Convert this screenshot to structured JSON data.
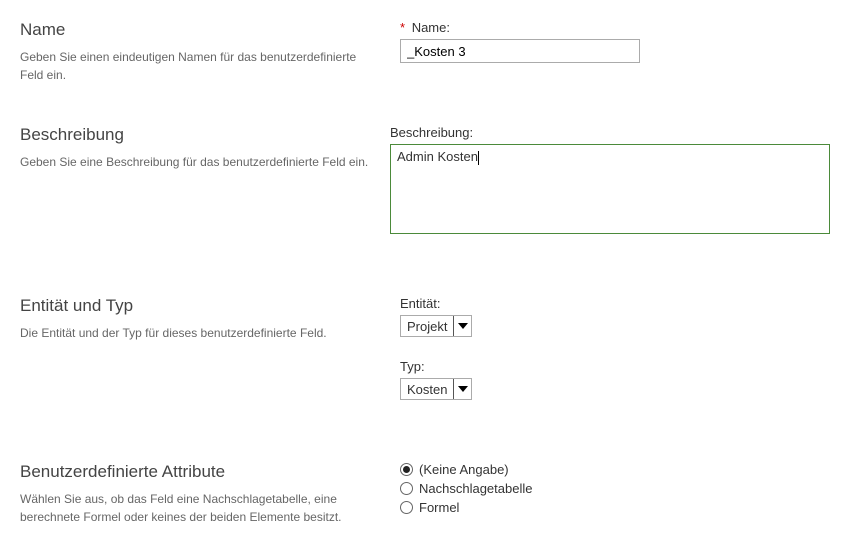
{
  "sections": {
    "name": {
      "title": "Name",
      "desc": "Geben Sie einen eindeutigen Namen für das benutzerdefinierte Feld ein.",
      "field_label": "Name:",
      "required_mark": "*",
      "value": "_Kosten 3"
    },
    "description": {
      "title": "Beschreibung",
      "desc": "Geben Sie eine Beschreibung für das benutzerdefinierte Feld ein.",
      "field_label": "Beschreibung:",
      "value": "Admin Kosten"
    },
    "entity_type": {
      "title": "Entität und Typ",
      "desc": "Die Entität und der Typ für dieses benutzerdefinierte Feld.",
      "entity_label": "Entität:",
      "entity_value": "Projekt",
      "type_label": "Typ:",
      "type_value": "Kosten"
    },
    "attributes": {
      "title": "Benutzerdefinierte Attribute",
      "desc": "Wählen Sie aus, ob das Feld eine Nachschlagetabelle, eine berechnete Formel oder keines der beiden Elemente besitzt.",
      "options": [
        {
          "label": "(Keine Angabe)",
          "selected": true
        },
        {
          "label": "Nachschlagetabelle",
          "selected": false
        },
        {
          "label": "Formel",
          "selected": false
        }
      ]
    }
  }
}
